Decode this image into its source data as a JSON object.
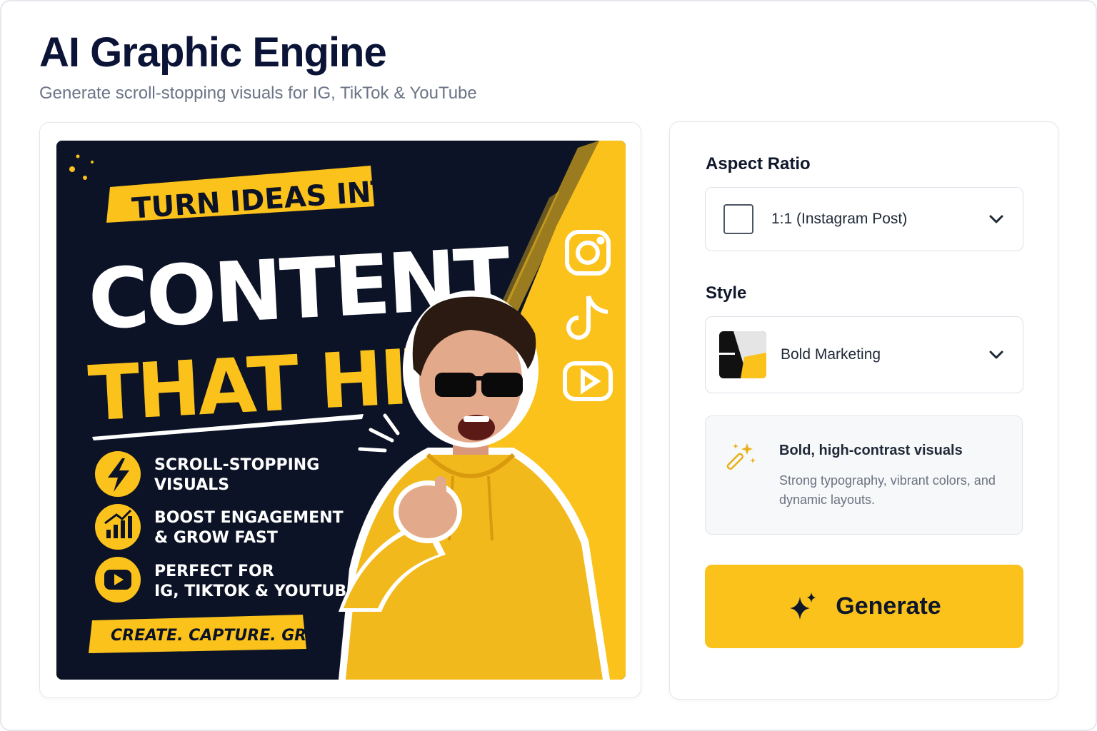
{
  "app": {
    "title": "AI Graphic Engine",
    "subtitle": "Generate scroll-stopping visuals for IG, TikTok & YouTube"
  },
  "preview": {
    "headline_top": "TURN IDEAS INTO",
    "headline_main": "CONTENT",
    "headline_accent": "THAT HITS",
    "features": [
      {
        "icon": "lightning-icon",
        "line1": "SCROLL-STOPPING",
        "line2": "VISUALS"
      },
      {
        "icon": "growth-chart-icon",
        "line1": "BOOST ENGAGEMENT",
        "line2": "& GROW FAST"
      },
      {
        "icon": "play-icon",
        "line1": "PERFECT FOR",
        "line2": "IG, TIKTOK & YOUTUBE"
      }
    ],
    "tagline": "CREATE. CAPTURE. GROW.",
    "social_icons": [
      "instagram-icon",
      "tiktok-icon",
      "youtube-icon"
    ],
    "colors": {
      "accent": "#fbc21b",
      "dark": "#0c1326",
      "white": "#ffffff"
    }
  },
  "controls": {
    "aspect_ratio": {
      "label": "Aspect Ratio",
      "value": "1:1 (Instagram Post)"
    },
    "style": {
      "label": "Style",
      "value": "Bold Marketing"
    },
    "info": {
      "title": "Bold, high-contrast visuals",
      "description": "Strong typography, vibrant colors, and dynamic layouts."
    },
    "generate": {
      "label": "Generate"
    },
    "colors": {
      "button": "#fbc21b"
    }
  }
}
